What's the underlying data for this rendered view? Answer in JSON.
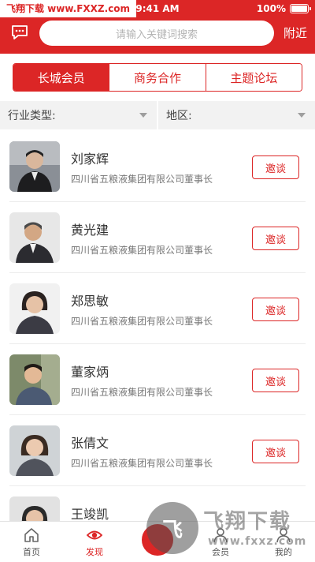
{
  "status_bar": {
    "watermark": "飞翔下载 www.FXXZ.com",
    "time": "9:41 AM",
    "battery": "100%",
    "battery_level": 1.0
  },
  "header": {
    "search_placeholder": "请输入关键词搜索",
    "nearby_label": "附近"
  },
  "tabs": [
    {
      "label": "长城会员",
      "active": true
    },
    {
      "label": "商务合作",
      "active": false
    },
    {
      "label": "主题论坛",
      "active": false
    }
  ],
  "filters": {
    "industry_label": "行业类型:",
    "region_label": "地区:"
  },
  "members": [
    {
      "name": "刘家辉",
      "company": "四川省五粮液集团有限公司董事长",
      "invite": "邀谈"
    },
    {
      "name": "黄光建",
      "company": "四川省五粮液集团有限公司董事长",
      "invite": "邀谈"
    },
    {
      "name": "郑思敏",
      "company": "四川省五粮液集团有限公司董事长",
      "invite": "邀谈"
    },
    {
      "name": "董家炳",
      "company": "四川省五粮液集团有限公司董事长",
      "invite": "邀谈"
    },
    {
      "name": "张倩文",
      "company": "四川省五粮液集团有限公司董事长",
      "invite": "邀谈"
    },
    {
      "name": "王竣凯",
      "company": "",
      "invite": ""
    }
  ],
  "bottom_nav": {
    "home": "首页",
    "discover": "发现",
    "members": "会员",
    "mine": "我的"
  },
  "watermark_bottom": {
    "logo": "飞",
    "text": "飞翔下载",
    "url": "www.fxxz.com"
  },
  "colors": {
    "brand_red": "#dc2626"
  }
}
